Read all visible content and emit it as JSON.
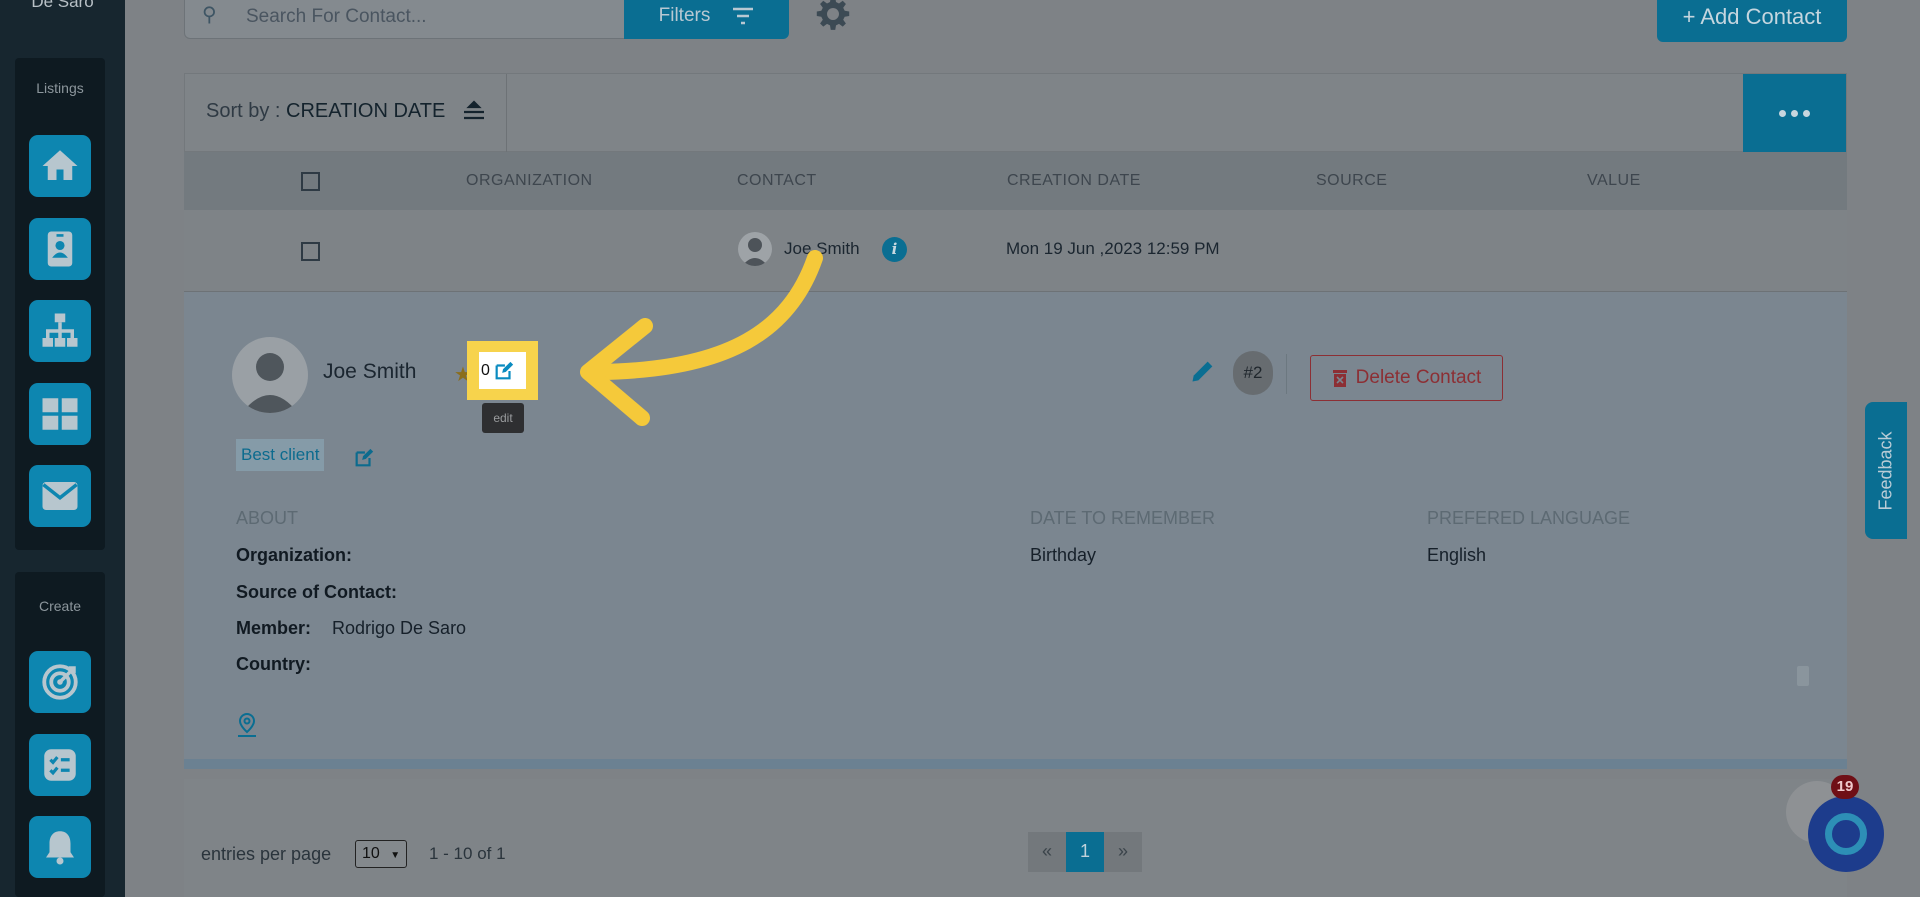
{
  "sidebar": {
    "brand": "De Saro",
    "listings_title": "Listings",
    "create_title": "Create",
    "listing_icons": [
      "home-icon",
      "contact-card-icon",
      "org-chart-icon",
      "grid-icon",
      "mail-icon"
    ],
    "create_icons": [
      "target-icon",
      "checklist-icon",
      "bell-icon"
    ]
  },
  "toolbar": {
    "search_placeholder": "Search For Contact...",
    "filters_label": "Filters",
    "add_contact_label": "+ Add Contact"
  },
  "sort": {
    "prefix": "Sort by : ",
    "field": "CREATION DATE"
  },
  "table": {
    "columns": [
      "ORGANIZATION",
      "CONTACT",
      "CREATION DATE",
      "SOURCE",
      "VALUE"
    ],
    "row": {
      "contact": "Joe Smith",
      "creation_date": "Mon 19 Jun ,2023 12:59 PM"
    }
  },
  "detail": {
    "name": "Joe Smith",
    "rating": "0",
    "tooltip": "edit",
    "tag": "Best client",
    "badge": "#2",
    "delete_label": "Delete Contact",
    "about_title": "ABOUT",
    "date_title": "DATE TO REMEMBER",
    "lang_title": "PREFERED LANGUAGE",
    "organization_label": "Organization:",
    "source_label": "Source of Contact:",
    "member_label": "Member:",
    "member_value": "Rodrigo De Saro",
    "country_label": "Country:",
    "date_value": "Birthday",
    "lang_value": "English"
  },
  "footer": {
    "entries_label": "entries per page",
    "per_page": "10",
    "range": "1 - 10 of 1",
    "prev": "«",
    "page": "1",
    "next": "»"
  },
  "feedback_label": "Feedback",
  "chat_badge": "19",
  "colors": {
    "accent": "#0a6e92",
    "highlight": "#f7d34c",
    "danger": "#8c2f34"
  }
}
